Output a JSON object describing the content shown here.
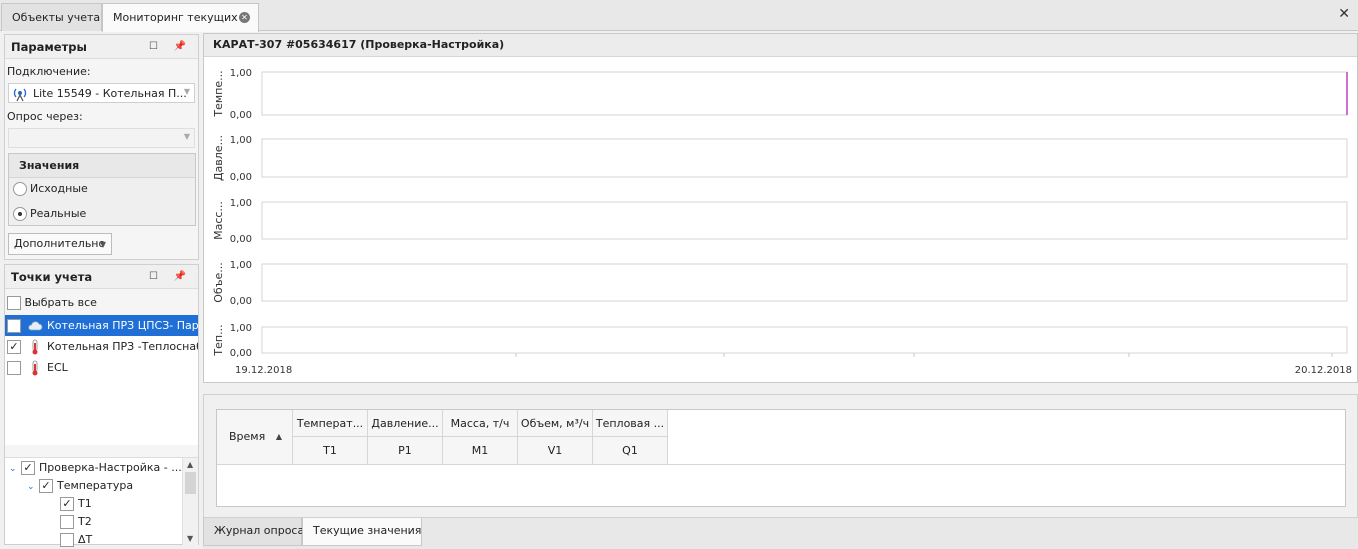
{
  "tabs": [
    {
      "label": "Объекты учета"
    },
    {
      "label": "Мониторинг текущих"
    }
  ],
  "params": {
    "title": "Параметры",
    "connection_label": "Подключение:",
    "connection_value": "Lite 15549 - Котельная П...",
    "poll_via_label": "Опрос через:",
    "poll_via_value": "",
    "values_title": "Значения",
    "radio_source": "Исходные",
    "radio_real": "Реальные",
    "selected_radio": "Реальные",
    "more_button": "Дополнительно"
  },
  "points": {
    "title": "Точки учета",
    "select_all": "Выбрать все",
    "items": [
      {
        "label": "Котельная ПРЗ ЦПСЗ- Пар",
        "checked": false,
        "selected": true,
        "icon": "cloud-icon"
      },
      {
        "label": "Котельная ПРЗ -Теплоснабжение",
        "checked": true,
        "selected": false,
        "icon": "thermometer-icon"
      },
      {
        "label": "ECL",
        "checked": false,
        "selected": false,
        "icon": "thermometer-icon"
      }
    ],
    "tree": [
      {
        "label": "Проверка-Настройка - ...",
        "checked": true
      },
      {
        "label": "Температура",
        "checked": true
      },
      {
        "label": "T1",
        "checked": true
      },
      {
        "label": "T2",
        "checked": false
      },
      {
        "label": "ΔT",
        "checked": false
      }
    ]
  },
  "chart": {
    "title": "КАРАТ-307 #05634617 (Проверка-Настройка)",
    "x_start": "19.12.2018",
    "x_end": "20.12.2018",
    "accent_color": "#c040c0"
  },
  "chart_data": {
    "type": "line",
    "x_range": [
      "19.12.2018",
      "20.12.2018"
    ],
    "panels": [
      {
        "ylabel": "Темпе...",
        "ylim": [
          0,
          1
        ],
        "ticks": [
          "1,00",
          "0,00"
        ]
      },
      {
        "ylabel": "Давле...",
        "ylim": [
          0,
          1
        ],
        "ticks": [
          "1,00",
          "0,00"
        ]
      },
      {
        "ylabel": "Масс...",
        "ylim": [
          0,
          1
        ],
        "ticks": [
          "1,00",
          "0,00"
        ]
      },
      {
        "ylabel": "Объе...",
        "ylim": [
          0,
          1
        ],
        "ticks": [
          "1,00",
          "0,00"
        ]
      },
      {
        "ylabel": "Теп...",
        "ylim": [
          0,
          1
        ],
        "ticks": [
          "1,00",
          "0,00"
        ]
      }
    ],
    "series": []
  },
  "grid": {
    "time_header": "Время",
    "columns": [
      {
        "header": "Температ...",
        "sub": "T1"
      },
      {
        "header": "Давление...",
        "sub": "P1"
      },
      {
        "header": "Масса, т/ч",
        "sub": "M1"
      },
      {
        "header": "Объем, м³/ч",
        "sub": "V1"
      },
      {
        "header": "Тепловая ...",
        "sub": "Q1"
      }
    ]
  },
  "bottom_tabs": [
    {
      "label": "Журнал опроса"
    },
    {
      "label": "Текущие значения"
    }
  ]
}
